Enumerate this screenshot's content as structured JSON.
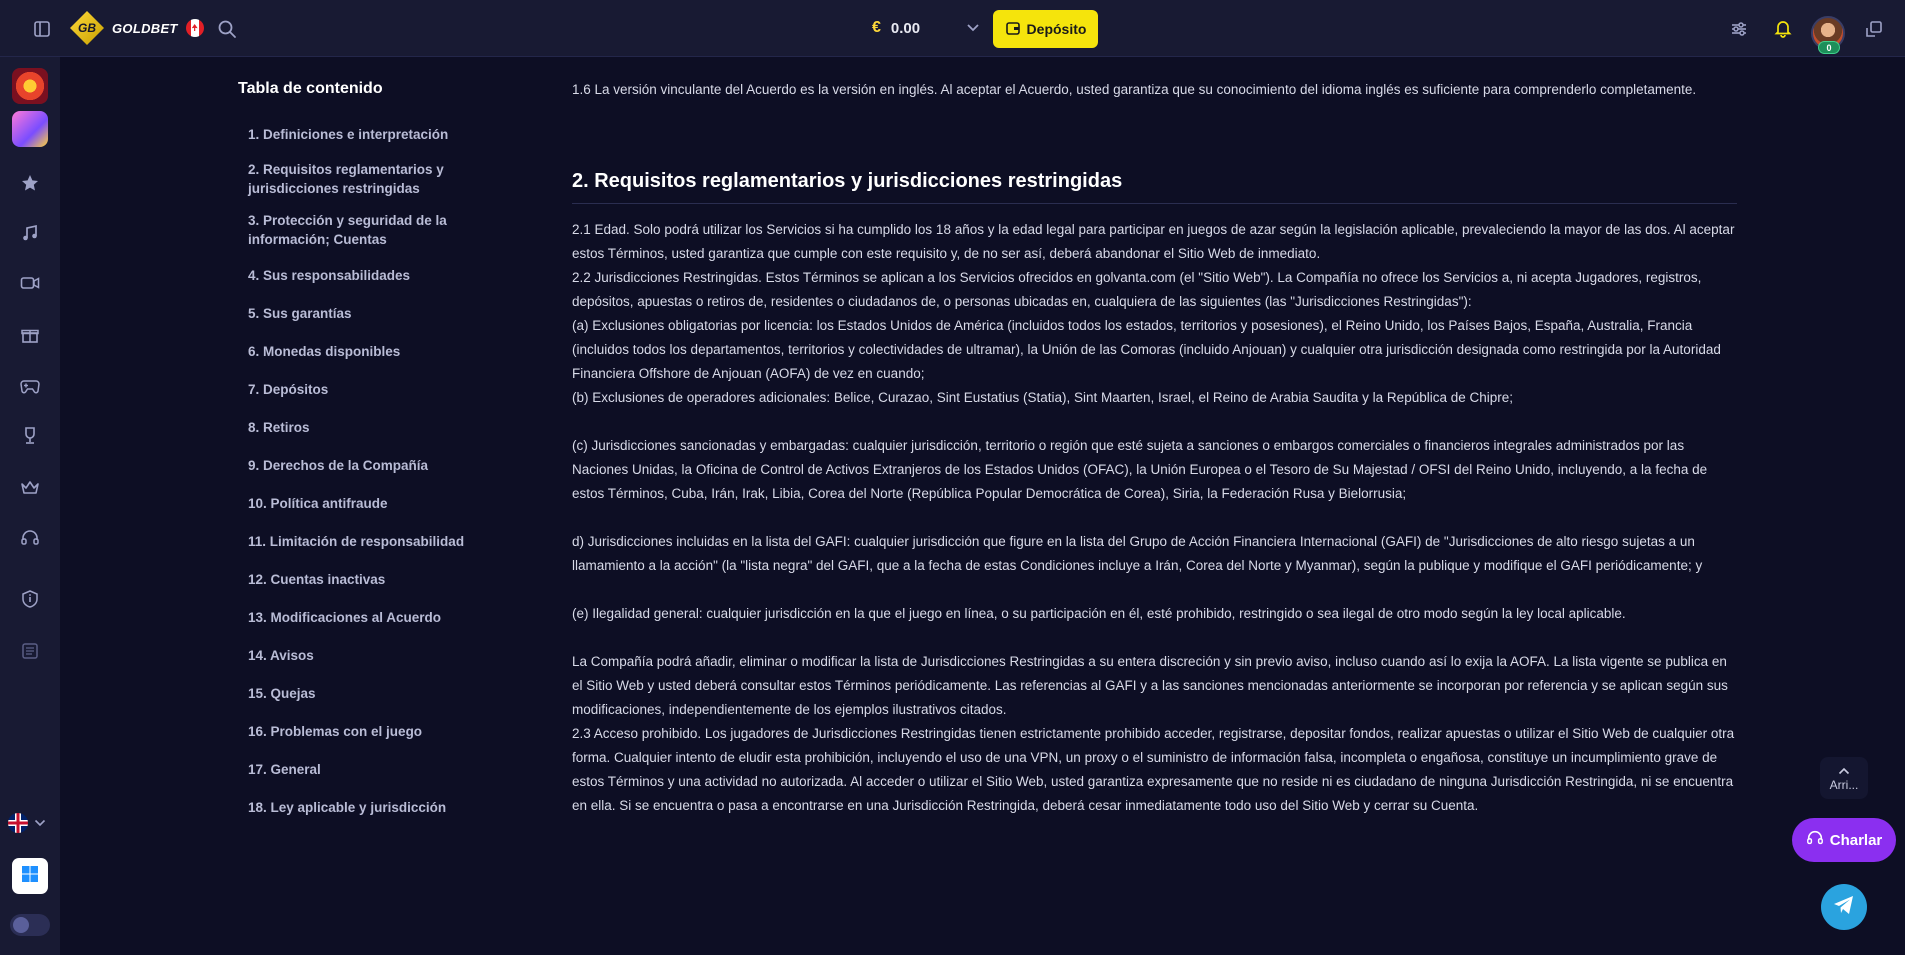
{
  "header": {
    "brand": "GOLDBET",
    "logo_mark": "GB",
    "currency_symbol": "€",
    "balance": "0.00",
    "deposit_label": "Depósito",
    "avatar_badge": "0",
    "icons": [
      "sidebar-toggle-icon",
      "search-icon",
      "chevron-down-icon",
      "wallet-icon",
      "sliders-icon",
      "bell-icon",
      "swap-icon"
    ],
    "colors": {
      "accent": "#f5e40c",
      "bg": "#181a33"
    }
  },
  "rail": {
    "icons": [
      "star-icon",
      "music-icon",
      "video-icon",
      "gift-icon",
      "gamepad-icon",
      "trophy-icon",
      "crown-icon",
      "headset-icon",
      "shield-info-icon",
      "document-icon"
    ]
  },
  "toc": {
    "title": "Tabla de contenido",
    "items": [
      "1. Definiciones e interpretación",
      "2. Requisitos reglamentarios y jurisdicciones restringidas",
      "3. Protección y seguridad de la información; Cuentas",
      "4. Sus responsabilidades",
      "5. Sus garantías",
      "6. Monedas disponibles",
      "7. Depósitos",
      "8. Retiros",
      "9. Derechos de la Compañía",
      "10. Política antifraude",
      "11. Limitación de responsabilidad",
      "12. Cuentas inactivas",
      "13. Modificaciones al Acuerdo",
      "14. Avisos",
      "15. Quejas",
      "16. Problemas con el juego",
      "17. General",
      "18. Ley aplicable y jurisdicción"
    ]
  },
  "content": {
    "p_1_6": "1.6 La versión vinculante del Acuerdo es la versión en inglés. Al aceptar el Acuerdo, usted garantiza que su conocimiento del idioma inglés es suficiente para comprenderlo completamente.",
    "section2_title": "2. Requisitos reglamentarios y jurisdicciones restringidas",
    "p_2_1": "2.1 Edad. Solo podrá utilizar los Servicios si ha cumplido los 18 años y la edad legal para participar en juegos de azar según la legislación aplicable, prevaleciendo la mayor de las dos. Al aceptar estos Términos, usted garantiza que cumple con este requisito y, de no ser así, deberá abandonar el Sitio Web de inmediato.",
    "p_2_2": "2.2 Jurisdicciones Restringidas. Estos Términos se aplican a los Servicios ofrecidos en golvanta.com (el \"Sitio Web\"). La Compañía no ofrece los Servicios a, ni acepta Jugadores, registros, depósitos, apuestas o retiros de, residentes o ciudadanos de, o personas ubicadas en, cualquiera de las siguientes (las \"Jurisdicciones Restringidas\"):",
    "p_a": "(a) Exclusiones obligatorias por licencia: los Estados Unidos de América (incluidos todos los estados, territorios y posesiones), el Reino Unido, los Países Bajos, España, Australia, Francia (incluidos todos los departamentos, territorios y colectividades de ultramar), la Unión de las Comoras (incluido Anjouan) y cualquier otra jurisdicción designada como restringida por la Autoridad Financiera Offshore de Anjouan (AOFA) de vez en cuando;",
    "p_b": "(b) Exclusiones de operadores adicionales: Belice, Curazao, Sint Eustatius (Statia), Sint Maarten, Israel, el Reino de Arabia Saudita y la República de Chipre;",
    "p_c": "(c) Jurisdicciones sancionadas y embargadas: cualquier jurisdicción, territorio o región que esté sujeta a sanciones o embargos comerciales o financieros integrales administrados por las Naciones Unidas, la Oficina de Control de Activos Extranjeros de los Estados Unidos (OFAC), la Unión Europea o el Tesoro de Su Majestad / OFSI del Reino Unido, incluyendo, a la fecha de estos Términos, Cuba, Irán, Irak, Libia, Corea del Norte (República Popular Democrática de Corea), Siria, la Federación Rusa y Bielorrusia;",
    "p_d": "d) Jurisdicciones incluidas en la lista del GAFI: cualquier jurisdicción que figure en la lista del Grupo de Acción Financiera Internacional (GAFI) de \"Jurisdicciones de alto riesgo sujetas a un llamamiento a la acción\" (la \"lista negra\" del GAFI, que a la fecha de estas Condiciones incluye a Irán, Corea del Norte y Myanmar), según la publique y modifique el GAFI periódicamente; y",
    "p_e": "(e) Ilegalidad general: cualquier jurisdicción en la que el juego en línea, o su participación en él, esté prohibido, restringido o sea ilegal de otro modo según la ley local aplicable.",
    "p_list": "La Compañía podrá añadir, eliminar o modificar la lista de Jurisdicciones Restringidas a su entera discreción y sin previo aviso, incluso cuando así lo exija la AOFA. La lista vigente se publica en el Sitio Web y usted deberá consultar estos Términos periódicamente. Las referencias al GAFI y a las sanciones mencionadas anteriormente se incorporan por referencia y se aplican según sus modificaciones, independientemente de los ejemplos ilustrativos citados.",
    "p_2_3": "2.3 Acceso prohibido. Los jugadores de Jurisdicciones Restringidas tienen estrictamente prohibido acceder, registrarse, depositar fondos, realizar apuestas o utilizar el Sitio Web de cualquier otra forma. Cualquier intento de eludir esta prohibición, incluyendo el uso de una VPN, un proxy o el suministro de información falsa, incompleta o engañosa, constituye un incumplimiento grave de estos Términos y una actividad no autorizada. Al acceder o utilizar el Sitio Web, usted garantiza expresamente que no reside ni es ciudadano de ninguna Jurisdicción Restringida, ni se encuentra en ella. Si se encuentra o pasa a encontrarse en una Jurisdicción Restringida, deberá cesar inmediatamente todo uso del Sitio Web y cerrar su Cuenta."
  },
  "floating": {
    "back_to_top": "Arri...",
    "chat_label": "Charlar"
  }
}
